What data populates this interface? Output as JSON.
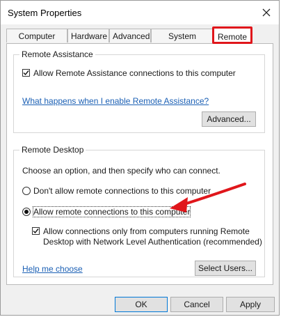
{
  "window": {
    "title": "System Properties"
  },
  "tabs": [
    {
      "label": "Computer Name"
    },
    {
      "label": "Hardware"
    },
    {
      "label": "Advanced"
    },
    {
      "label": "System Protection"
    },
    {
      "label": "Remote"
    }
  ],
  "remote_assistance": {
    "group_title": "Remote Assistance",
    "allow_checkbox_label": "Allow Remote Assistance connections to this computer",
    "allow_checked": true,
    "help_link": "What happens when I enable Remote Assistance?",
    "advanced_button": "Advanced..."
  },
  "remote_desktop": {
    "group_title": "Remote Desktop",
    "instruction": "Choose an option, and then specify who can connect.",
    "option_dont_allow": "Don't allow remote connections to this computer",
    "option_allow": "Allow remote connections to this computer",
    "selected_option": "allow",
    "nla_checkbox_line1": "Allow connections only from computers running Remote",
    "nla_checkbox_line2": "Desktop with Network Level Authentication (recommended)",
    "nla_checked": true,
    "help_link": "Help me choose",
    "select_users_button": "Select Users..."
  },
  "footer": {
    "ok": "OK",
    "cancel": "Cancel",
    "apply": "Apply"
  },
  "colors": {
    "annotation_red": "#e0161b",
    "link_blue": "#1a5fb4"
  }
}
